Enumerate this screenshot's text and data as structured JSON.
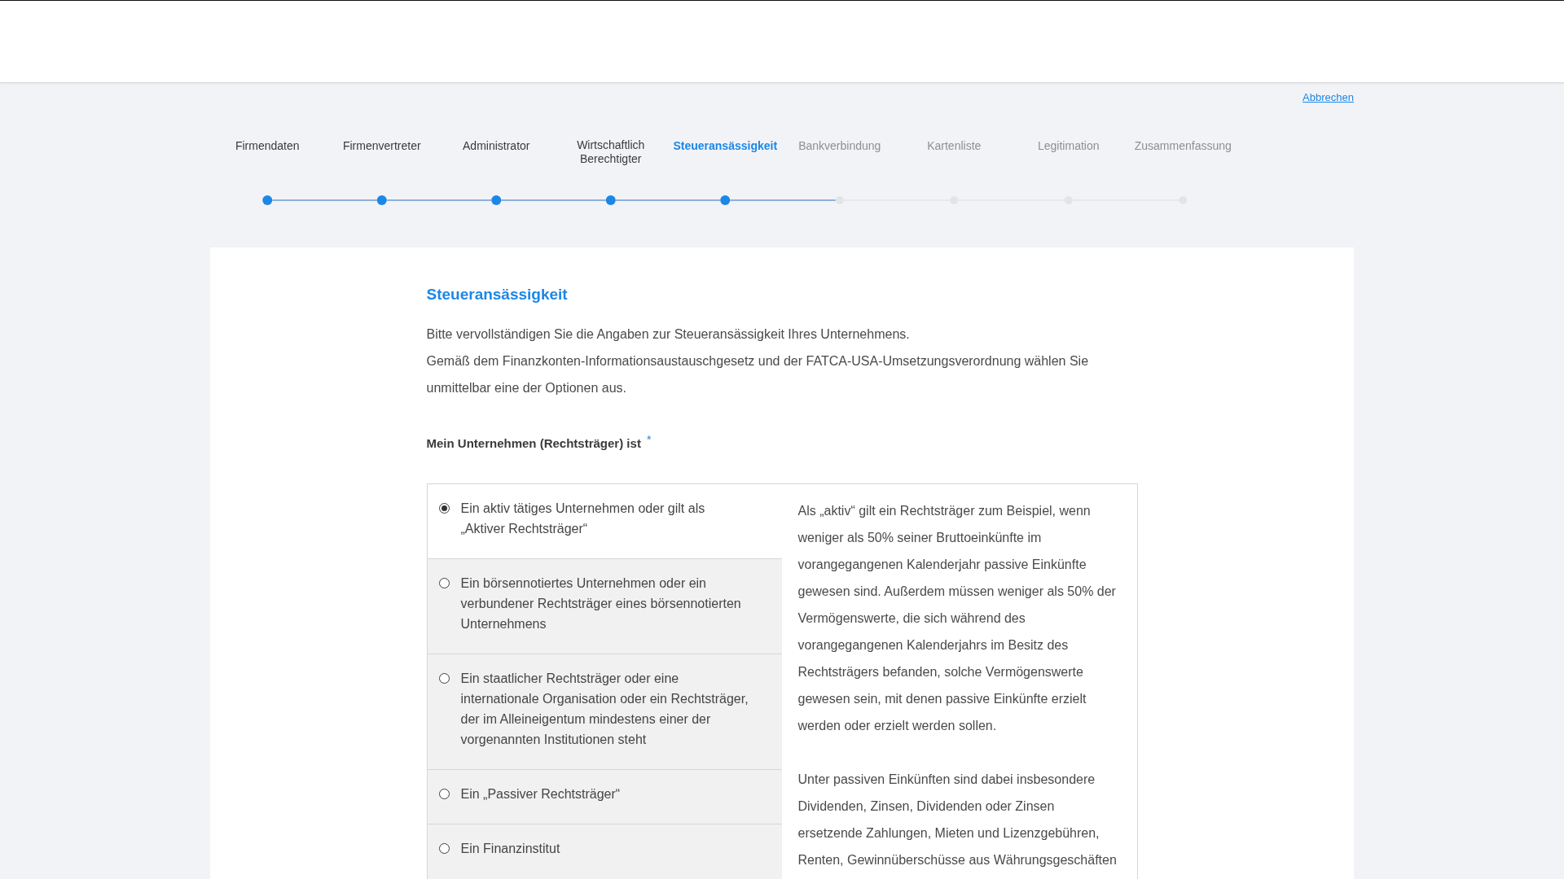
{
  "cancel_link": "Abbrechen",
  "steps": [
    {
      "label": "Firmendaten",
      "selected": false
    },
    {
      "label": "Firmenvertreter",
      "selected": false
    },
    {
      "label": "Administrator",
      "selected": false
    },
    {
      "label": "Wirtschaftlich Berechtigter",
      "selected": false
    },
    {
      "label": "Steueransässigkeit",
      "selected": true
    },
    {
      "label": "Bankverbindung",
      "selected": false
    },
    {
      "label": "Kartenliste",
      "selected": false
    },
    {
      "label": "Legitimation",
      "selected": false
    },
    {
      "label": "Zusammenfassung",
      "selected": false
    }
  ],
  "form": {
    "title": "Steueransässigkeit",
    "intro": [
      "Bitte vervollständigen Sie die Angaben zur Steueransässigkeit Ihres Unternehmens.",
      "Gemäß dem Finanzkonten-Informationsaustauschgesetz und der FATCA-USA-Umsetzungsverordnung wählen Sie unmittelbar eine der Optionen aus."
    ],
    "question": {
      "label": "Mein Unternehmen (Rechtsträger) ist",
      "required_marker": "*"
    },
    "options": [
      {
        "label": "Ein aktiv tätiges Unternehmen oder gilt als „Aktiver Rechtsträger“",
        "selected": true
      },
      {
        "label": "Ein börsennotiertes Unternehmen oder ein verbundener Rechtsträger eines börsennotierten Unternehmens",
        "selected": false
      },
      {
        "label": "Ein staatlicher Rechtsträger oder eine internationale Organisation oder ein Rechtsträger, der im Alleineigentum mindestens einer der vorgenannten Institutionen steht",
        "selected": false
      },
      {
        "label": "Ein „Passiver Rechtsträger“",
        "selected": false
      },
      {
        "label": "Ein Finanzinstitut",
        "selected": false
      }
    ],
    "info_text": [
      "Als „aktiv“ gilt ein Rechtsträger zum Beispiel, wenn weniger als 50% seiner Bruttoeinkünfte im vorangegangenen Kalenderjahr passive Einkünfte gewesen sind. Außerdem müssen weniger als 50% der Vermögenswerte, die sich während des vorangegangenen Kalenderjahrs im Besitz des Rechtsträgers befanden, solche Vermögenswerte gewesen sein, mit denen passive Einkünfte erzielt werden oder erzielt werden sollen.",
      "Unter passiven Einkünften sind dabei insbesondere Dividenden, Zinsen, Dividenden oder Zinsen ersetzende Zahlungen, Mieten und Lizenzgebühren, Renten, Gewinnüberschüsse aus Währungsgeschäften"
    ]
  }
}
